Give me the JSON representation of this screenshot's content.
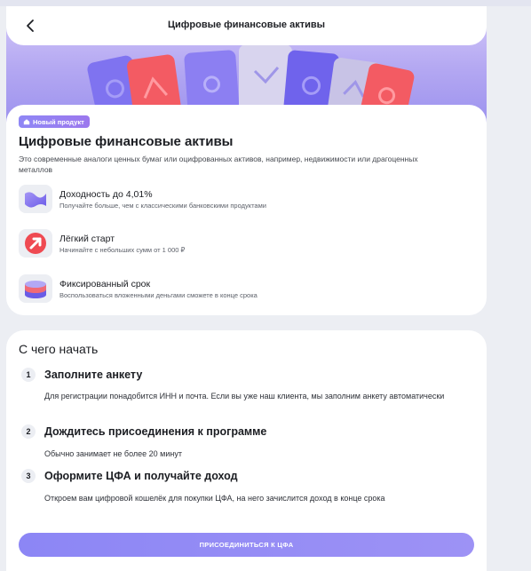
{
  "header": {
    "title": "Цифровые финансовые активы",
    "back_icon": "chevron-left-icon"
  },
  "product": {
    "badge": "Новый продукт",
    "badge_icon": "house-icon",
    "title": "Цифровые финансовые активы",
    "description": "Это современные аналоги ценных бумаг или оцифрованных активов, например, недвижимости или драгоценных металлов",
    "features": [
      {
        "icon": "wave-icon",
        "title": "Доходность до 4,01%",
        "subtitle": "Получайте больше, чем с классическими банковскими продуктами"
      },
      {
        "icon": "arrow-up-right-icon",
        "title": "Лёгкий старт",
        "subtitle": "Начинайте с небольших сумм от 1 000 ₽"
      },
      {
        "icon": "stack-icon",
        "title": "Фиксированный срок",
        "subtitle": "Воспользоваться вложенными деньгами сможете в конце срока"
      }
    ]
  },
  "how_to": {
    "title": "С чего начать",
    "steps": [
      {
        "number": "1",
        "title": "Заполните анкету",
        "description": "Для регистрации понадобится ИНН и почта. Если вы уже наш клиента, мы заполним анкету автоматически"
      },
      {
        "number": "2",
        "title": "Дождитесь присоединения к программе",
        "description": "Обычно занимает не более 20 минут"
      },
      {
        "number": "3",
        "title": "Оформите ЦФА и получайте доход",
        "description": "Откроем вам цифровой кошелёк для покупки ЦФА, на него зачислится доход в конце срока"
      }
    ],
    "cta_label": "ПРИСОЕДИНИТЬСЯ К ЦФА"
  },
  "colors": {
    "accent": "#8f88f5",
    "background": "#eceef3",
    "card": "#ffffff"
  }
}
